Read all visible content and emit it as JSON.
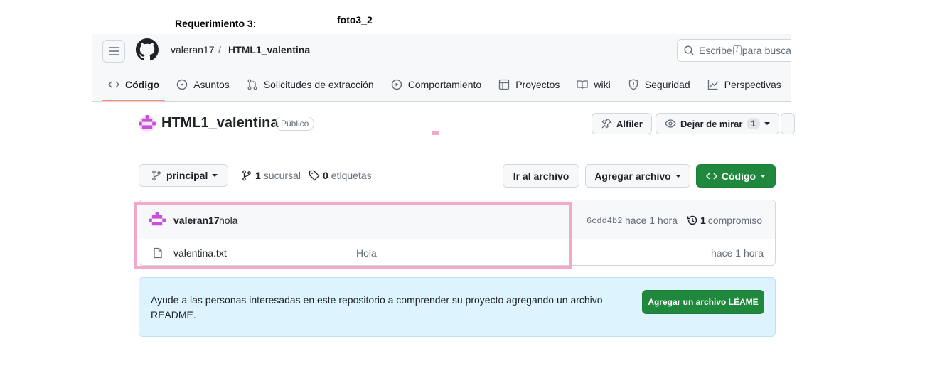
{
  "document": {
    "requirement_label": "Requerimiento 3:",
    "photo_label": "foto3_2"
  },
  "header": {
    "owner": "valeran17",
    "separator": "/",
    "repo": "HTML1_valentina",
    "search_prefix": "Escribe",
    "search_key": "/",
    "search_suffix": "para buscar"
  },
  "tabs": [
    {
      "label": "Código",
      "icon": "code-icon",
      "active": true
    },
    {
      "label": "Asuntos",
      "icon": "issue-icon"
    },
    {
      "label": "Solicitudes de extracción",
      "icon": "pull-request-icon"
    },
    {
      "label": "Comportamiento",
      "icon": "play-icon"
    },
    {
      "label": "Proyectos",
      "icon": "table-icon"
    },
    {
      "label": "wiki",
      "icon": "book-icon"
    },
    {
      "label": "Seguridad",
      "icon": "shield-icon"
    },
    {
      "label": "Perspectivas",
      "icon": "graph-icon"
    }
  ],
  "repo_header": {
    "name": "HTML1_valentina",
    "visibility": "Público",
    "pin_label": "Alfiler",
    "watch_label": "Dejar de mirar",
    "watch_count": "1"
  },
  "toolbar": {
    "branch": "principal",
    "branches_count": "1",
    "branches_label": "sucursal",
    "tags_count": "0",
    "tags_label": "etiquetas",
    "goto_file": "Ir al archivo",
    "add_file": "Agregar archivo",
    "code": "Código"
  },
  "latest_commit": {
    "author": "valeran17",
    "message": "hola",
    "sha": "6cdd4b2",
    "time": "hace 1 hora",
    "count": "1",
    "count_label": "compromiso"
  },
  "files": [
    {
      "name": "valentina.txt",
      "message": "Hola",
      "time": "hace 1 hora"
    }
  ],
  "readme_prompt": {
    "text": "Ayude a las personas interesadas en este repositorio a comprender su proyecto agregando un archivo README.",
    "button": "Agregar un archivo LÉAME"
  },
  "colors": {
    "accent_green": "#1f883d",
    "tab_underline": "#fd8c73",
    "highlight": "#f4a7c6",
    "readme_bg": "#ddf4ff"
  }
}
